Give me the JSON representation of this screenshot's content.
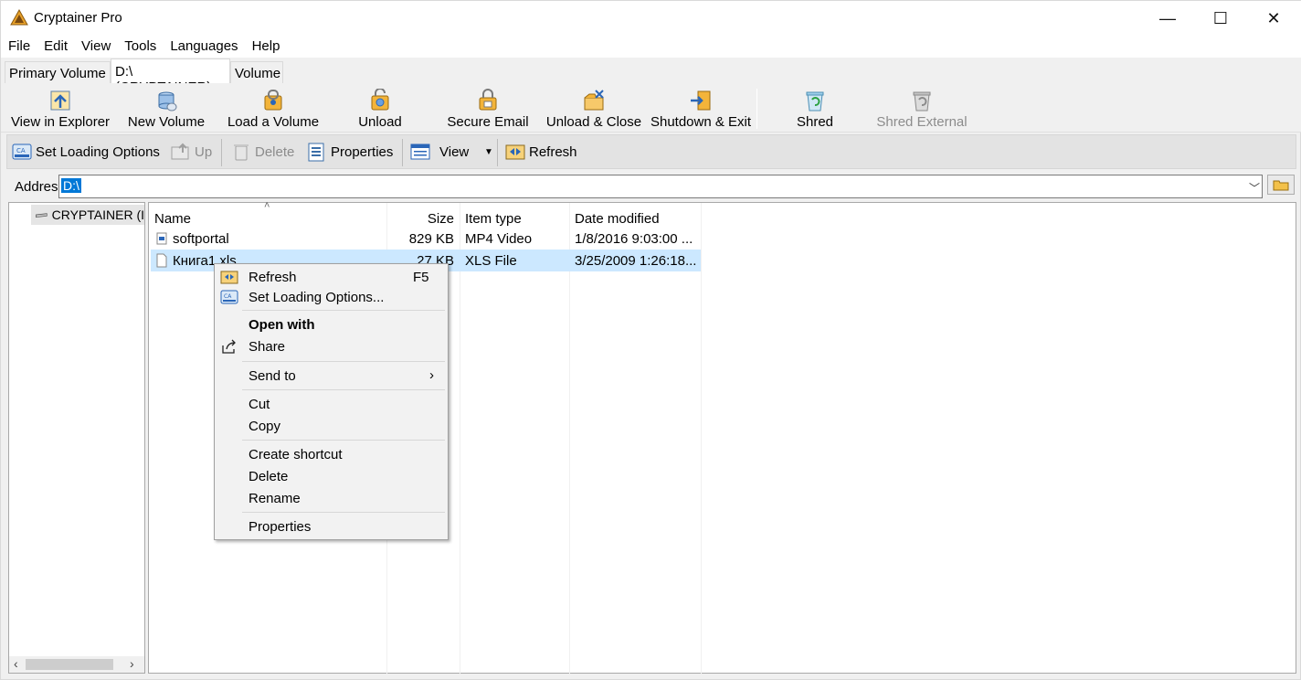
{
  "window": {
    "title": "Cryptainer Pro",
    "minimize_glyph": "—",
    "maximize_glyph": "☐",
    "close_glyph": "✕"
  },
  "menu": [
    "File",
    "Edit",
    "View",
    "Tools",
    "Languages",
    "Help"
  ],
  "tabs": [
    {
      "label": "Primary Volume",
      "active": false
    },
    {
      "label": "D:\\ (CRYPTAINER)",
      "active": true
    },
    {
      "label": "Volume",
      "active": false
    }
  ],
  "big_toolbar": [
    {
      "label": "View in Explorer",
      "icon": "explorer-icon"
    },
    {
      "label": "New Volume",
      "icon": "new-volume-icon"
    },
    {
      "label": "Load a Volume",
      "icon": "load-volume-icon"
    },
    {
      "label": "Unload",
      "icon": "unload-icon"
    },
    {
      "label": "Secure Email",
      "icon": "secure-email-icon"
    },
    {
      "label": "Unload & Close",
      "icon": "unload-close-icon"
    },
    {
      "label": "Shutdown & Exit",
      "icon": "shutdown-exit-icon"
    },
    {
      "label": "Shred",
      "icon": "shred-icon"
    },
    {
      "label": "Shred External",
      "icon": "shred-external-icon",
      "disabled": true
    }
  ],
  "small_toolbar": {
    "set_loading_options": "Set Loading Options",
    "up": "Up",
    "delete": "Delete",
    "properties": "Properties",
    "view": "View",
    "refresh": "Refresh"
  },
  "address": {
    "label": "Addres",
    "value": "D:\\"
  },
  "tree": {
    "node_label": "CRYPTAINER (I"
  },
  "columns": [
    "Name",
    "Size",
    "Item type",
    "Date modified"
  ],
  "files": [
    {
      "name": "softportal",
      "size": "829 KB",
      "type": "MP4 Video",
      "date": "1/8/2016 9:03:00 ...",
      "selected": false
    },
    {
      "name": "Книга1.xls",
      "size": "27 KB",
      "type": "XLS File",
      "date": "3/25/2009 1:26:18...",
      "selected": true
    }
  ],
  "context_menu": {
    "refresh": "Refresh",
    "refresh_shortcut": "F5",
    "set_loading_options": "Set Loading Options...",
    "open_with": "Open with",
    "share": "Share",
    "send_to": "Send to",
    "cut": "Cut",
    "copy": "Copy",
    "create_shortcut": "Create shortcut",
    "delete": "Delete",
    "rename": "Rename",
    "properties": "Properties"
  },
  "colors": {
    "selection": "#cce8ff",
    "address_highlight": "#0078d7",
    "accent_orange": "#e8a12a"
  }
}
